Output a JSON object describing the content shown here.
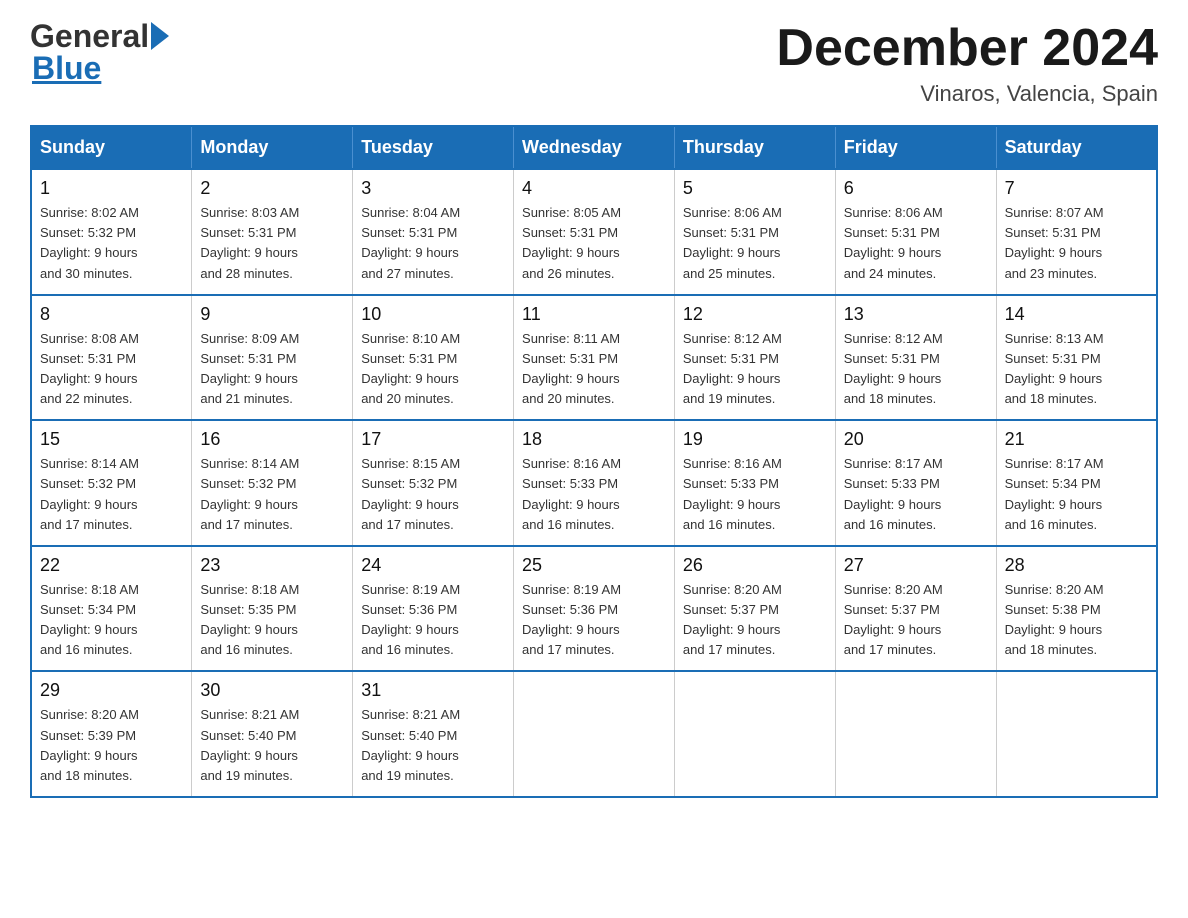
{
  "header": {
    "title": "December 2024",
    "subtitle": "Vinaros, Valencia, Spain",
    "logo_general": "General",
    "logo_blue": "Blue"
  },
  "columns": [
    "Sunday",
    "Monday",
    "Tuesday",
    "Wednesday",
    "Thursday",
    "Friday",
    "Saturday"
  ],
  "weeks": [
    [
      {
        "day": "1",
        "sunrise": "8:02 AM",
        "sunset": "5:32 PM",
        "daylight": "9 hours and 30 minutes."
      },
      {
        "day": "2",
        "sunrise": "8:03 AM",
        "sunset": "5:31 PM",
        "daylight": "9 hours and 28 minutes."
      },
      {
        "day": "3",
        "sunrise": "8:04 AM",
        "sunset": "5:31 PM",
        "daylight": "9 hours and 27 minutes."
      },
      {
        "day": "4",
        "sunrise": "8:05 AM",
        "sunset": "5:31 PM",
        "daylight": "9 hours and 26 minutes."
      },
      {
        "day": "5",
        "sunrise": "8:06 AM",
        "sunset": "5:31 PM",
        "daylight": "9 hours and 25 minutes."
      },
      {
        "day": "6",
        "sunrise": "8:06 AM",
        "sunset": "5:31 PM",
        "daylight": "9 hours and 24 minutes."
      },
      {
        "day": "7",
        "sunrise": "8:07 AM",
        "sunset": "5:31 PM",
        "daylight": "9 hours and 23 minutes."
      }
    ],
    [
      {
        "day": "8",
        "sunrise": "8:08 AM",
        "sunset": "5:31 PM",
        "daylight": "9 hours and 22 minutes."
      },
      {
        "day": "9",
        "sunrise": "8:09 AM",
        "sunset": "5:31 PM",
        "daylight": "9 hours and 21 minutes."
      },
      {
        "day": "10",
        "sunrise": "8:10 AM",
        "sunset": "5:31 PM",
        "daylight": "9 hours and 20 minutes."
      },
      {
        "day": "11",
        "sunrise": "8:11 AM",
        "sunset": "5:31 PM",
        "daylight": "9 hours and 20 minutes."
      },
      {
        "day": "12",
        "sunrise": "8:12 AM",
        "sunset": "5:31 PM",
        "daylight": "9 hours and 19 minutes."
      },
      {
        "day": "13",
        "sunrise": "8:12 AM",
        "sunset": "5:31 PM",
        "daylight": "9 hours and 18 minutes."
      },
      {
        "day": "14",
        "sunrise": "8:13 AM",
        "sunset": "5:31 PM",
        "daylight": "9 hours and 18 minutes."
      }
    ],
    [
      {
        "day": "15",
        "sunrise": "8:14 AM",
        "sunset": "5:32 PM",
        "daylight": "9 hours and 17 minutes."
      },
      {
        "day": "16",
        "sunrise": "8:14 AM",
        "sunset": "5:32 PM",
        "daylight": "9 hours and 17 minutes."
      },
      {
        "day": "17",
        "sunrise": "8:15 AM",
        "sunset": "5:32 PM",
        "daylight": "9 hours and 17 minutes."
      },
      {
        "day": "18",
        "sunrise": "8:16 AM",
        "sunset": "5:33 PM",
        "daylight": "9 hours and 16 minutes."
      },
      {
        "day": "19",
        "sunrise": "8:16 AM",
        "sunset": "5:33 PM",
        "daylight": "9 hours and 16 minutes."
      },
      {
        "day": "20",
        "sunrise": "8:17 AM",
        "sunset": "5:33 PM",
        "daylight": "9 hours and 16 minutes."
      },
      {
        "day": "21",
        "sunrise": "8:17 AM",
        "sunset": "5:34 PM",
        "daylight": "9 hours and 16 minutes."
      }
    ],
    [
      {
        "day": "22",
        "sunrise": "8:18 AM",
        "sunset": "5:34 PM",
        "daylight": "9 hours and 16 minutes."
      },
      {
        "day": "23",
        "sunrise": "8:18 AM",
        "sunset": "5:35 PM",
        "daylight": "9 hours and 16 minutes."
      },
      {
        "day": "24",
        "sunrise": "8:19 AM",
        "sunset": "5:36 PM",
        "daylight": "9 hours and 16 minutes."
      },
      {
        "day": "25",
        "sunrise": "8:19 AM",
        "sunset": "5:36 PM",
        "daylight": "9 hours and 17 minutes."
      },
      {
        "day": "26",
        "sunrise": "8:20 AM",
        "sunset": "5:37 PM",
        "daylight": "9 hours and 17 minutes."
      },
      {
        "day": "27",
        "sunrise": "8:20 AM",
        "sunset": "5:37 PM",
        "daylight": "9 hours and 17 minutes."
      },
      {
        "day": "28",
        "sunrise": "8:20 AM",
        "sunset": "5:38 PM",
        "daylight": "9 hours and 18 minutes."
      }
    ],
    [
      {
        "day": "29",
        "sunrise": "8:20 AM",
        "sunset": "5:39 PM",
        "daylight": "9 hours and 18 minutes."
      },
      {
        "day": "30",
        "sunrise": "8:21 AM",
        "sunset": "5:40 PM",
        "daylight": "9 hours and 19 minutes."
      },
      {
        "day": "31",
        "sunrise": "8:21 AM",
        "sunset": "5:40 PM",
        "daylight": "9 hours and 19 minutes."
      },
      null,
      null,
      null,
      null
    ]
  ],
  "labels": {
    "sunrise": "Sunrise: ",
    "sunset": "Sunset: ",
    "daylight": "Daylight: "
  }
}
